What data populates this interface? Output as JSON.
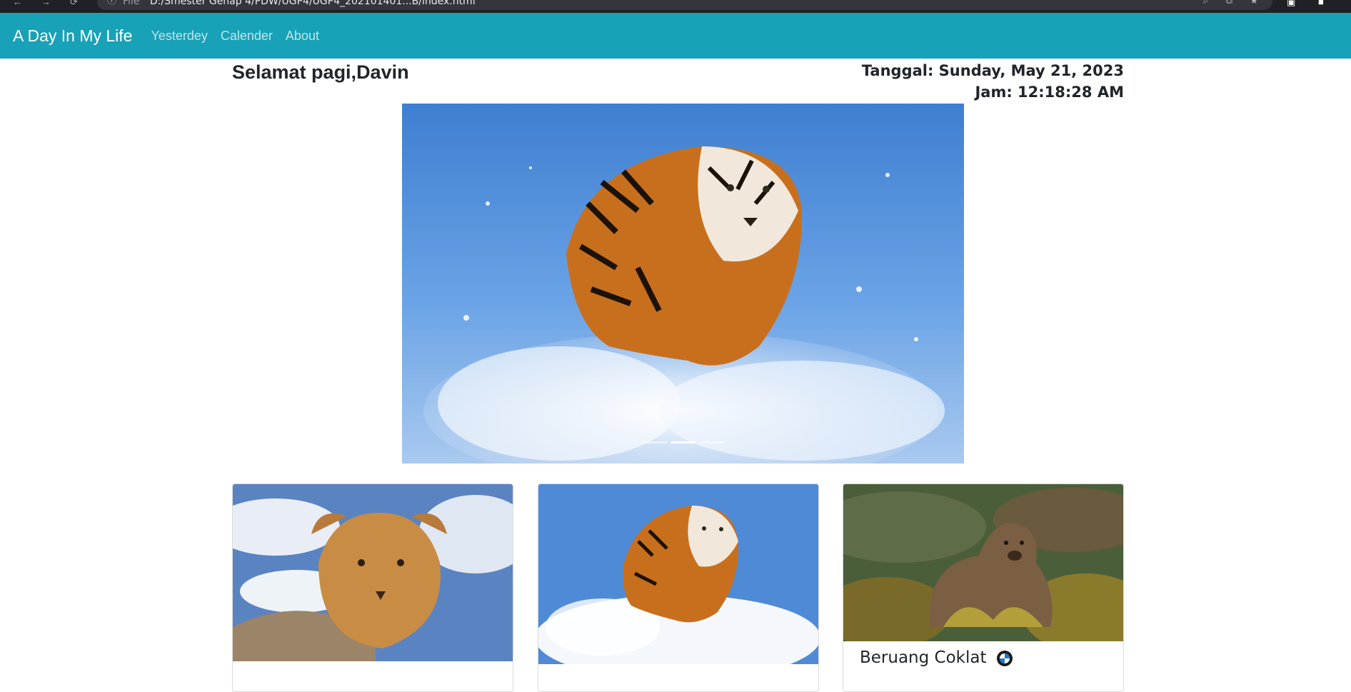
{
  "browser": {
    "address_prefix": "File",
    "address": "D:/Smester Genap 4/PDW/UGP4/UGP4_202101401...B/index.html"
  },
  "navbar": {
    "brand": "A Day In My Life",
    "links": [
      "Yesterdey",
      "Calender",
      "About"
    ],
    "color": "#17a2b8"
  },
  "header": {
    "greeting": "Selamat pagi,Davin",
    "date": "Tanggal: Sunday, May 21, 2023",
    "time": "Jam: 12:18:28 AM"
  },
  "carousel": {
    "slide_count": 3,
    "active_index": 1,
    "image": "tiger running through water"
  },
  "cards": [
    {
      "image": "lion cub on rock",
      "title": ""
    },
    {
      "image": "tiger running through water",
      "title": ""
    },
    {
      "image": "brown bear in grass",
      "title": "Beruang Coklat"
    }
  ],
  "icons": {
    "back": "arrow-left-icon",
    "forward": "arrow-right-icon",
    "reload": "reload-icon",
    "info": "info-icon",
    "search": "search-icon",
    "share": "share-icon",
    "bookmark": "star-icon",
    "extensions": "extension-icon",
    "menu": "menu-icon",
    "emoji": "bmw-logo-icon"
  }
}
